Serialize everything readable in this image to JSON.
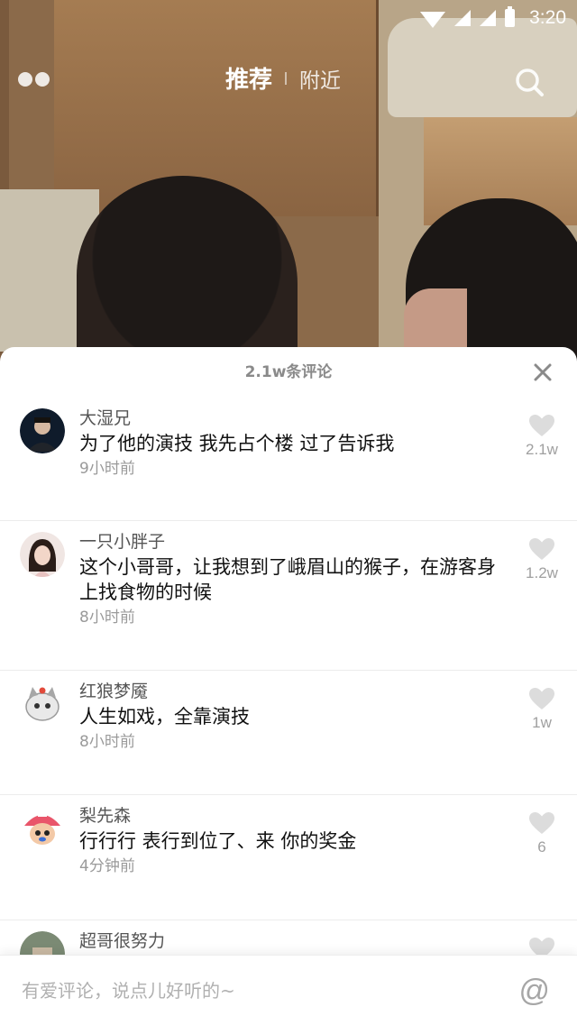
{
  "status_bar": {
    "time": "3:20",
    "icons": [
      "wifi-icon",
      "signal-icon",
      "signal-icon",
      "battery-icon"
    ]
  },
  "top_nav": {
    "menu_icon": "dots-menu-icon",
    "tabs": [
      {
        "label": "推荐",
        "active": true
      },
      {
        "label": "附近",
        "active": false
      }
    ],
    "search_icon": "search-icon"
  },
  "comments_panel": {
    "count_label": "2.1w条评论",
    "close_icon": "close-icon",
    "comments": [
      {
        "username": "大湿兄",
        "text": "为了他的演技 我先占个楼 过了告诉我",
        "time": "9小时前",
        "likes": "2.1w"
      },
      {
        "username": "一只小胖子",
        "text": "这个小哥哥，让我想到了峨眉山的猴子，在游客身上找食物的时候",
        "time": "8小时前",
        "likes": "1.2w"
      },
      {
        "username": "红狼梦魇",
        "text": "人生如戏，全靠演技",
        "time": "8小时前",
        "likes": "1w"
      },
      {
        "username": "梨先森",
        "text": "行行行 表行到位了、来 你的奖金",
        "time": "4分钟前",
        "likes": "6"
      },
      {
        "username": "超哥很努力",
        "text": "",
        "time": "",
        "likes": ""
      }
    ]
  },
  "input_bar": {
    "placeholder": "有爱评论，说点儿好听的~",
    "at_label": "@"
  },
  "colors": {
    "sheet_bg": "#ffffff",
    "muted_text": "#9a9a9a",
    "heart": "#dcdcdc"
  }
}
